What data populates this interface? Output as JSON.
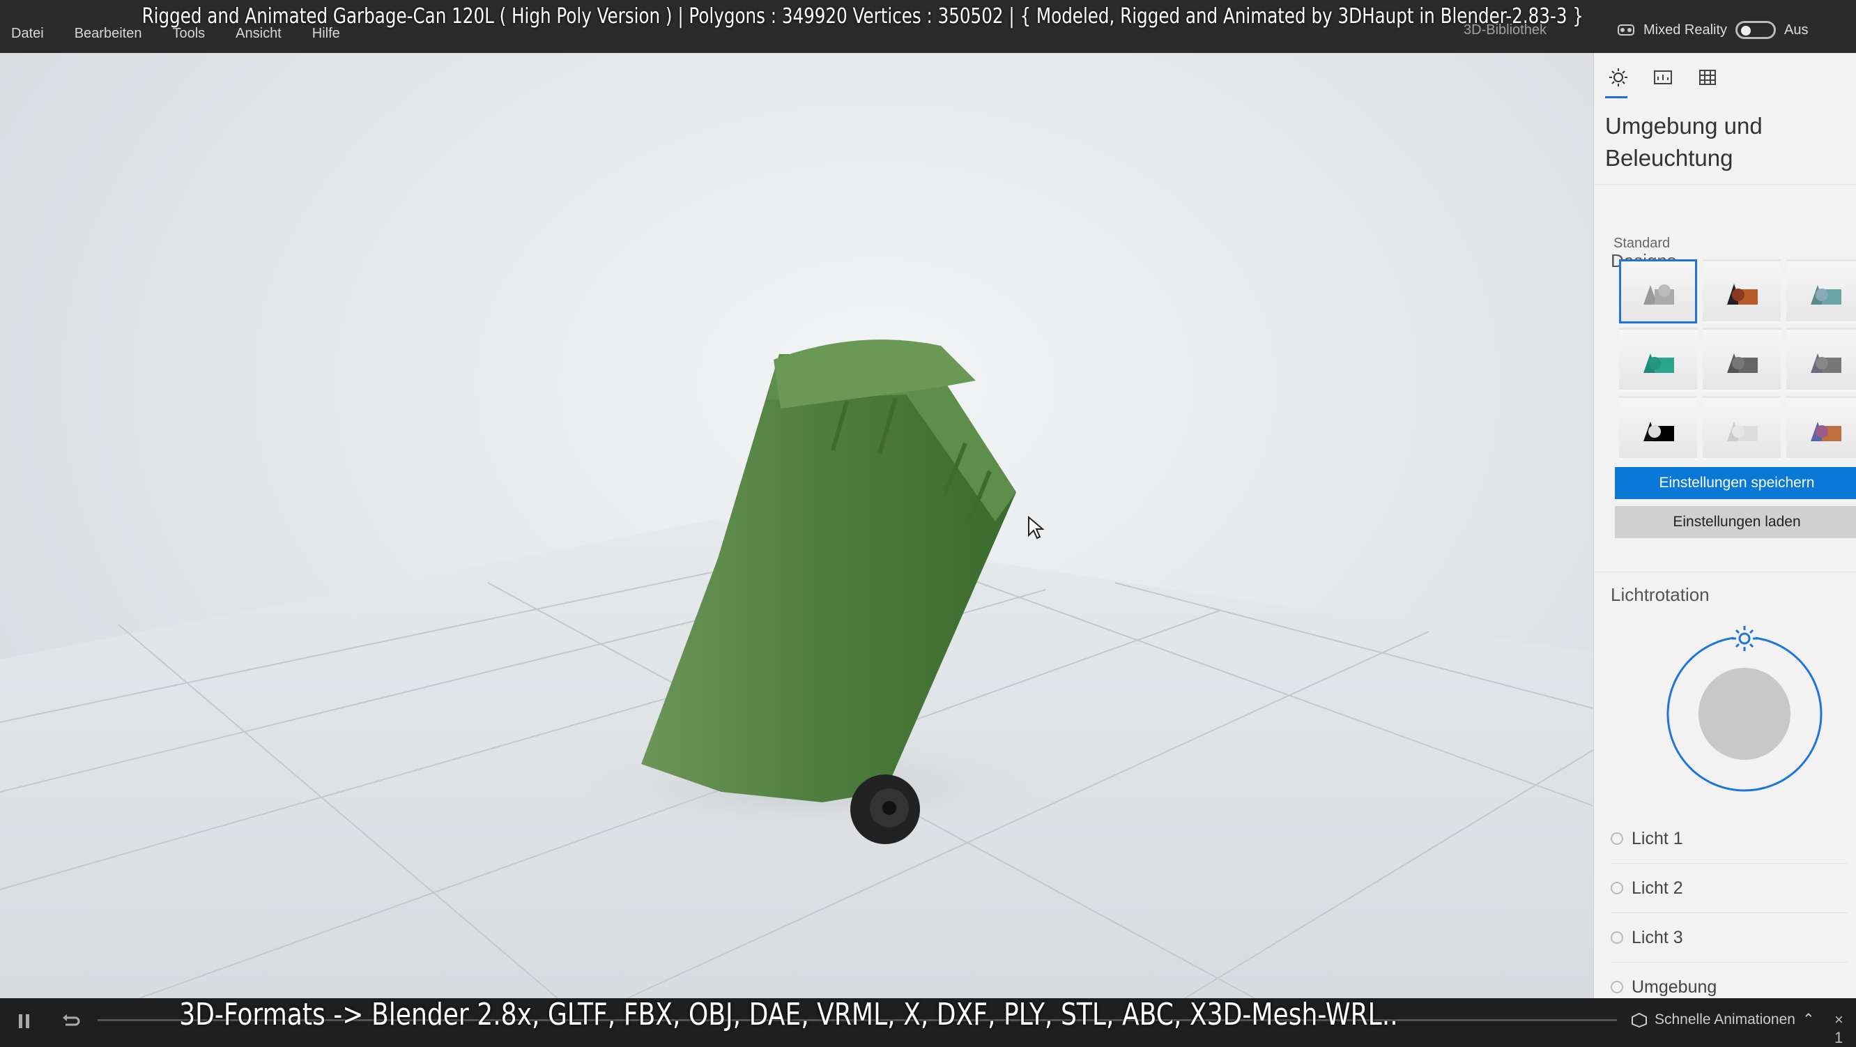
{
  "menu": [
    "Datei",
    "Bearbeiten",
    "Tools",
    "Ansicht",
    "Hilfe"
  ],
  "title_overlay": "Rigged and Animated Garbage-Can 120L ( High Poly Version )  |   Polygons : 349920  Vertices : 350502    |   { Modeled, Rigged and Animated by 3DHaupt in Blender-2.83-3 }",
  "library_label": "3D-Bibliothek",
  "mixed_reality": {
    "label": "Mixed Reality",
    "state": "Aus"
  },
  "panel": {
    "title": "Umgebung und Beleuchtung",
    "designs_title": "Designs",
    "designs_sub": "Standard",
    "save_btn": "Einstellungen speichern",
    "load_btn": "Einstellungen laden",
    "rotation_title": "Lichtrotation",
    "lights": [
      "Licht 1",
      "Licht 2",
      "Licht 3",
      "Umgebung"
    ]
  },
  "bottom_overlay": "3D-Formats -> Blender 2.8x, GLTF, FBX, OBJ, DAE, VRML, X, DXF, PLY, STL, ABC, X3D-Mesh-WRL..",
  "bottom_bar": {
    "animations_label": "Schnelle Animationen",
    "zoom_label": "1"
  },
  "colors": {
    "accent": "#0a78d7",
    "can_green": "#4f7f3f",
    "panel_bg": "#f2f2f2"
  }
}
